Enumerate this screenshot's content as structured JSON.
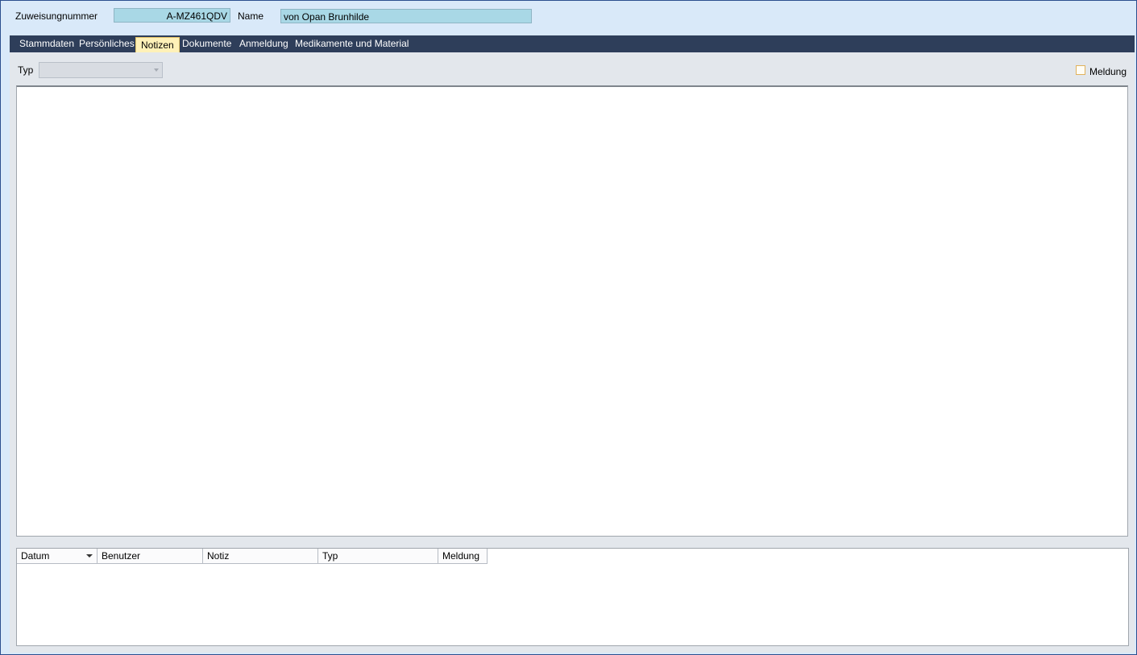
{
  "header": {
    "zuweisung_label": "Zuweisungnummer",
    "zuweisung_value": "A-MZ461QDV",
    "name_label": "Name",
    "name_value": "von Opan Brunhilde"
  },
  "tabs": [
    {
      "label": "Stammdaten",
      "active": false
    },
    {
      "label": "Persönliches",
      "active": false
    },
    {
      "label": "Notizen",
      "active": true
    },
    {
      "label": "Dokumente",
      "active": false
    },
    {
      "label": "Anmeldung",
      "active": false
    },
    {
      "label": "Medikamente und Material",
      "active": false
    }
  ],
  "notes": {
    "typ_label": "Typ",
    "typ_value": "",
    "meldung_label": "Meldung",
    "meldung_checked": false,
    "editor_text": ""
  },
  "grid": {
    "columns": [
      "Datum",
      "Benutzer",
      "Notiz",
      "Typ",
      "Meldung"
    ],
    "rows": []
  },
  "colors": {
    "header_bg": "#d9e9f9",
    "field_bg": "#a9d8e6",
    "tabbar_bg": "#2e3e5a",
    "active_tab_bg": "#fff1b8",
    "content_bg": "#e3e7ec"
  }
}
